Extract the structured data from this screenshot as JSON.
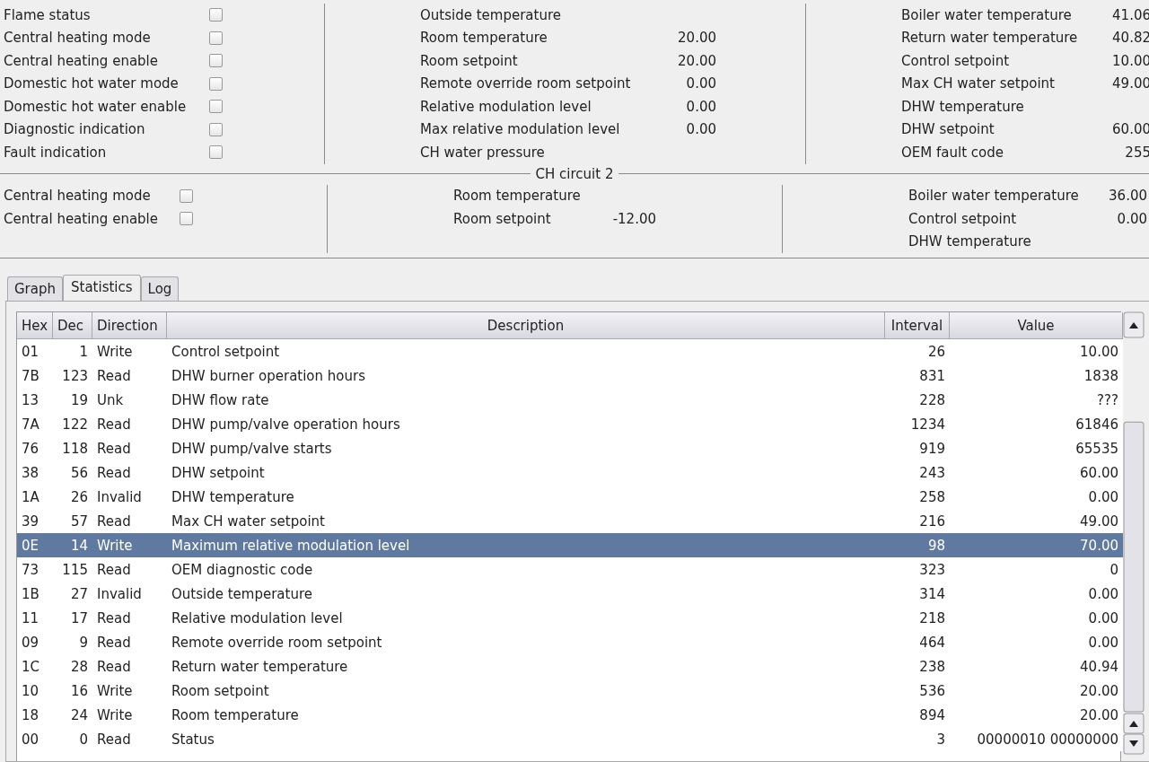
{
  "status_flags": [
    {
      "label": "Flame status",
      "checked": false
    },
    {
      "label": "Central heating mode",
      "checked": false
    },
    {
      "label": "Central heating enable",
      "checked": false
    },
    {
      "label": "Domestic hot water mode",
      "checked": false
    },
    {
      "label": "Domestic hot water enable",
      "checked": false
    },
    {
      "label": "Diagnostic indication",
      "checked": false
    },
    {
      "label": "Fault indication",
      "checked": false
    }
  ],
  "room_readings": [
    {
      "label": "Outside temperature"
    },
    {
      "label": "Room temperature",
      "value": "20.00"
    },
    {
      "label": "Room setpoint",
      "value": "20.00"
    },
    {
      "label": "Remote override room setpoint",
      "value": "0.00"
    },
    {
      "label": "Relative modulation level",
      "value": "0.00"
    },
    {
      "label": "Max relative modulation level",
      "value": "0.00"
    },
    {
      "label": "CH water pressure"
    }
  ],
  "boiler_readings": [
    {
      "label": "Boiler water temperature",
      "value": "41.06"
    },
    {
      "label": "Return water temperature",
      "value": "40.82"
    },
    {
      "label": "Control setpoint",
      "value": "10.00"
    },
    {
      "label": "Max CH water setpoint",
      "value": "49.00"
    },
    {
      "label": "DHW temperature"
    },
    {
      "label": "DHW setpoint",
      "value": "60.00"
    },
    {
      "label": "OEM fault code",
      "value": "255"
    }
  ],
  "ch_circuit_2": {
    "title": "CH circuit 2",
    "status_flags": [
      {
        "label": "Central heating mode",
        "checked": false
      },
      {
        "label": "Central heating enable",
        "checked": false
      }
    ],
    "room_readings": [
      {
        "label": "Room temperature"
      },
      {
        "label": "Room setpoint",
        "value": "-12.00"
      }
    ],
    "boiler_readings": [
      {
        "label": "Boiler water temperature",
        "value": "36.00"
      },
      {
        "label": "Control setpoint",
        "value": "0.00"
      },
      {
        "label": "DHW temperature"
      }
    ]
  },
  "tabs": [
    {
      "label": "Graph",
      "selected": false
    },
    {
      "label": "Statistics",
      "selected": true
    },
    {
      "label": "Log",
      "selected": false
    }
  ],
  "table": {
    "columns": [
      "Hex",
      "Dec",
      "Direction",
      "Description",
      "Interval",
      "Value"
    ],
    "rows": [
      {
        "cells": [
          "01",
          "1",
          "Write",
          "Control setpoint",
          "26",
          "10.00"
        ],
        "selected": false
      },
      {
        "cells": [
          "7B",
          "123",
          "Read",
          "DHW burner operation hours",
          "831",
          "1838"
        ],
        "selected": false
      },
      {
        "cells": [
          "13",
          "19",
          "Unk",
          "DHW flow rate",
          "228",
          "???"
        ],
        "selected": false
      },
      {
        "cells": [
          "7A",
          "122",
          "Read",
          "DHW pump/valve operation hours",
          "1234",
          "61846"
        ],
        "selected": false
      },
      {
        "cells": [
          "76",
          "118",
          "Read",
          "DHW pump/valve starts",
          "919",
          "65535"
        ],
        "selected": false
      },
      {
        "cells": [
          "38",
          "56",
          "Read",
          "DHW setpoint",
          "243",
          "60.00"
        ],
        "selected": false
      },
      {
        "cells": [
          "1A",
          "26",
          "Invalid",
          "DHW temperature",
          "258",
          "0.00"
        ],
        "selected": false
      },
      {
        "cells": [
          "39",
          "57",
          "Read",
          "Max CH water setpoint",
          "216",
          "49.00"
        ],
        "selected": false
      },
      {
        "cells": [
          "0E",
          "14",
          "Write",
          "Maximum relative modulation level",
          "98",
          "70.00"
        ],
        "selected": true
      },
      {
        "cells": [
          "73",
          "115",
          "Read",
          "OEM diagnostic code",
          "323",
          "0"
        ],
        "selected": false
      },
      {
        "cells": [
          "1B",
          "27",
          "Invalid",
          "Outside temperature",
          "314",
          "0.00"
        ],
        "selected": false
      },
      {
        "cells": [
          "11",
          "17",
          "Read",
          "Relative modulation level",
          "218",
          "0.00"
        ],
        "selected": false
      },
      {
        "cells": [
          "09",
          "9",
          "Read",
          "Remote override room setpoint",
          "464",
          "0.00"
        ],
        "selected": false
      },
      {
        "cells": [
          "1C",
          "28",
          "Read",
          "Return water temperature",
          "238",
          "40.94"
        ],
        "selected": false
      },
      {
        "cells": [
          "10",
          "16",
          "Write",
          "Room setpoint",
          "536",
          "20.00"
        ],
        "selected": false
      },
      {
        "cells": [
          "18",
          "24",
          "Write",
          "Room temperature",
          "894",
          "20.00"
        ],
        "selected": false
      },
      {
        "cells": [
          "00",
          "0",
          "Read",
          "Status",
          "3",
          "00000010 00000000"
        ],
        "selected": false
      }
    ]
  }
}
